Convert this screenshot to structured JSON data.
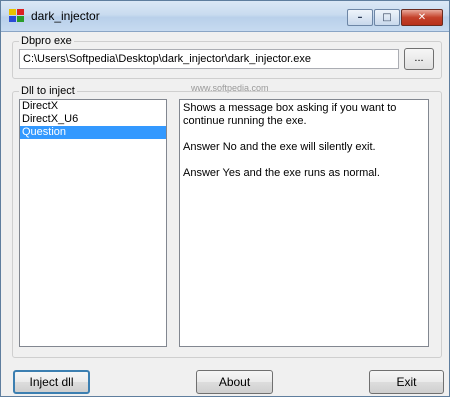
{
  "window": {
    "title": "dark_injector"
  },
  "titlebar": {
    "minimize": "–",
    "maximize": "□",
    "close": "✕"
  },
  "dbpro": {
    "label": "Dbpro exe",
    "path": "C:\\Users\\Softpedia\\Desktop\\dark_injector\\dark_injector.exe",
    "browse_label": "..."
  },
  "dll": {
    "label": "Dll to inject",
    "items": [
      "DirectX",
      "DirectX_U6",
      "Question"
    ],
    "selected_index": 2,
    "description": [
      "Shows a message box asking if you want to continue running the exe.",
      "Answer No and the exe will silently exit.",
      "Answer Yes and the exe runs as normal."
    ]
  },
  "watermark": "www.softpedia.com",
  "buttons": {
    "inject": "Inject dll",
    "about": "About",
    "exit": "Exit"
  },
  "colors": {
    "selection": "#3399ff",
    "titlebar": "#c9dbef"
  }
}
